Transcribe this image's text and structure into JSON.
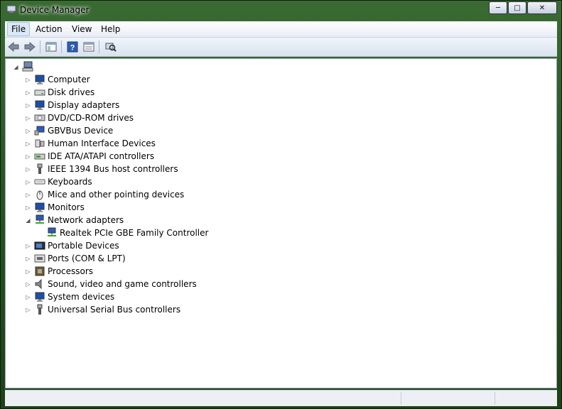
{
  "window": {
    "title": "Device Manager"
  },
  "caption_buttons": {
    "minimize": "─",
    "maximize": "□",
    "close": "✕"
  },
  "menu": [
    {
      "label": "File",
      "active": true
    },
    {
      "label": "Action"
    },
    {
      "label": "View"
    },
    {
      "label": "Help"
    }
  ],
  "toolbar": [
    "back-icon",
    "forward-icon",
    "console-tree-icon",
    "help-icon",
    "properties-icon",
    "scan-hardware-icon"
  ],
  "tree": {
    "root_label": "",
    "items": [
      {
        "label": "Computer",
        "icon": "computer-icon"
      },
      {
        "label": "Disk drives",
        "icon": "disk-drive-icon"
      },
      {
        "label": "Display adapters",
        "icon": "display-adapter-icon"
      },
      {
        "label": "DVD/CD-ROM drives",
        "icon": "dvd-icon"
      },
      {
        "label": "GBVBus Device",
        "icon": "bus-device-icon"
      },
      {
        "label": "Human Interface Devices",
        "icon": "hid-icon"
      },
      {
        "label": "IDE ATA/ATAPI controllers",
        "icon": "ide-icon"
      },
      {
        "label": "IEEE 1394 Bus host controllers",
        "icon": "ieee1394-icon"
      },
      {
        "label": "Keyboards",
        "icon": "keyboard-icon"
      },
      {
        "label": "Mice and other pointing devices",
        "icon": "mouse-icon"
      },
      {
        "label": "Monitors",
        "icon": "monitor-icon"
      },
      {
        "label": "Network adapters",
        "icon": "network-adapter-icon",
        "expanded": true,
        "children": [
          {
            "label": "Realtek PCIe GBE Family Controller",
            "icon": "network-adapter-icon"
          }
        ]
      },
      {
        "label": "Portable Devices",
        "icon": "portable-device-icon"
      },
      {
        "label": "Ports (COM & LPT)",
        "icon": "port-icon"
      },
      {
        "label": "Processors",
        "icon": "processor-icon"
      },
      {
        "label": "Sound, video and game controllers",
        "icon": "sound-icon"
      },
      {
        "label": "System devices",
        "icon": "system-device-icon"
      },
      {
        "label": "Universal Serial Bus controllers",
        "icon": "usb-icon"
      }
    ]
  }
}
